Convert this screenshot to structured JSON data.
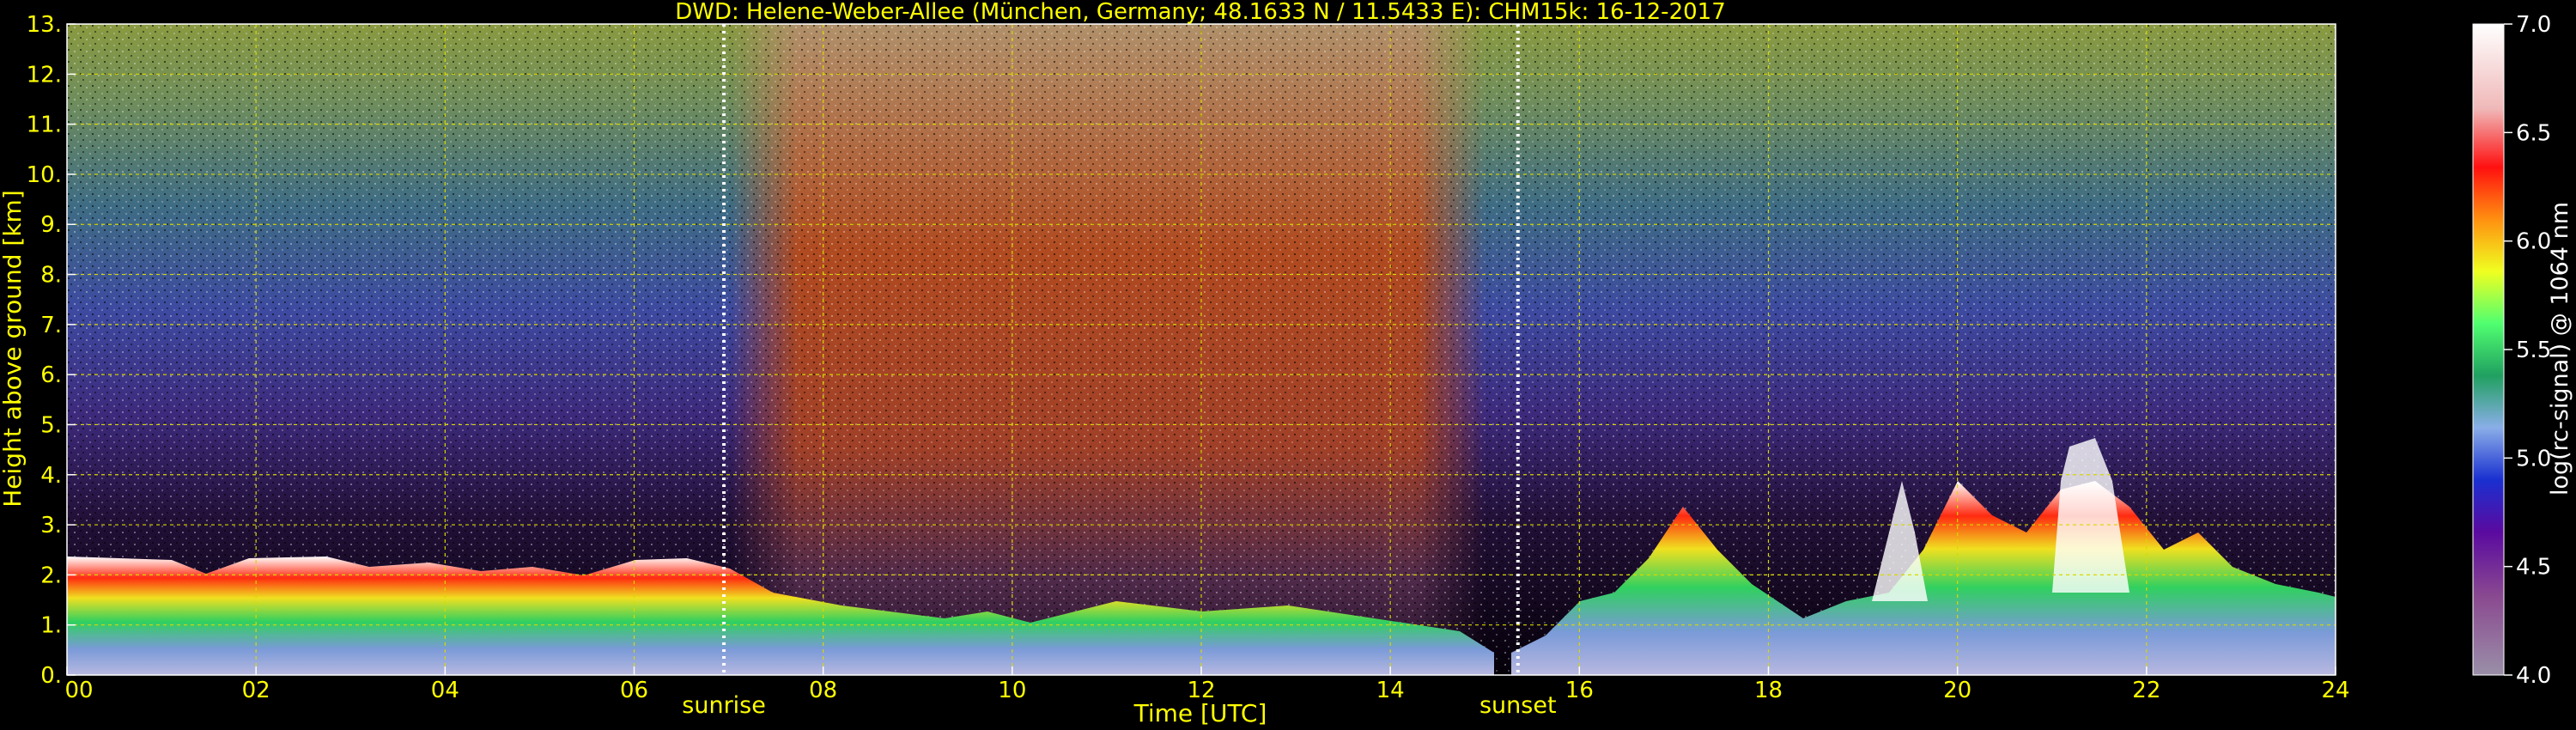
{
  "chart_data": {
    "type": "heatmap",
    "title": "DWD: Helene-Weber-Allee (München, Germany; 48.1633 N / 11.5433 E):    CHM15k: 16-12-2017",
    "xlabel": "Time [UTC]",
    "ylabel": "Height above ground [km]",
    "xlim": [
      0,
      24
    ],
    "ylim": [
      0,
      13
    ],
    "x_ticks": [
      "00",
      "02",
      "04",
      "06",
      "08",
      "10",
      "12",
      "14",
      "16",
      "18",
      "20",
      "22",
      "24"
    ],
    "y_ticks": [
      "0.",
      "1.",
      "2.",
      "3.",
      "4.",
      "5.",
      "6.",
      "7.",
      "8.",
      "9.",
      "10.",
      "11.",
      "12.",
      "13."
    ],
    "grid": true,
    "annotations": [
      {
        "label": "sunrise",
        "x": 6.95
      },
      {
        "label": "sunset",
        "x": 15.35
      }
    ],
    "colorbar": {
      "label": "log(rc-signal) @ 1064 nm",
      "range": [
        4.0,
        7.0
      ],
      "ticks": [
        "4.0",
        "4.5",
        "5.0",
        "5.5",
        "6.0",
        "6.5",
        "7.0"
      ]
    },
    "layers": [
      {
        "name": "noise-day",
        "x_start": 7.0,
        "x_end": 14.0,
        "y_top": 13,
        "value": 6.0
      },
      {
        "name": "noise-night-left",
        "x_start": 0,
        "x_end": 7.0,
        "y_top": 13,
        "value": 5.4
      },
      {
        "name": "noise-night-right",
        "x_start": 14.0,
        "x_end": 24,
        "y_top": 13,
        "value": 5.4
      },
      {
        "name": "boundary-layer",
        "x_start": 0,
        "x_end": 7.0,
        "y_top": 2.2,
        "value": 5.5
      }
    ]
  },
  "colors": {
    "text": "#ffff00",
    "colorbar_ticks": "#ffffff",
    "grid": "#d8d800",
    "background": "#000000"
  }
}
